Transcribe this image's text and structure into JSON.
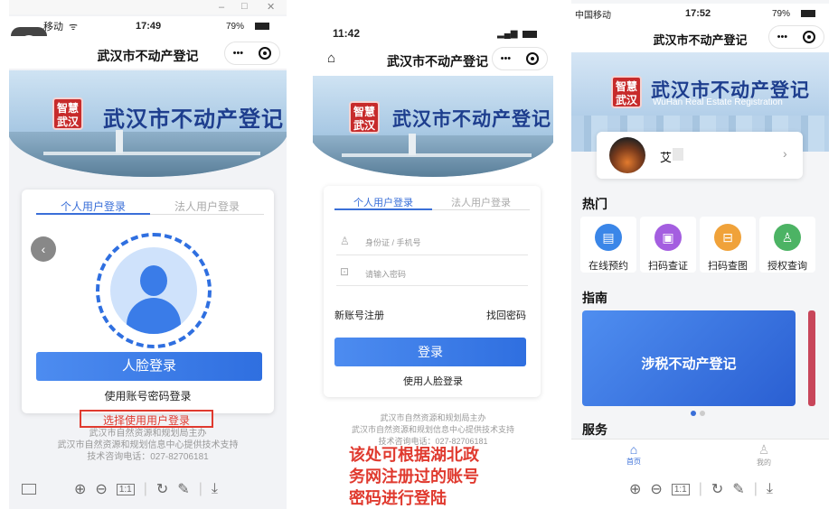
{
  "panel1": {
    "status": {
      "carrier": "移动",
      "time": "17:49",
      "battery": "79%"
    },
    "nav_title": "武汉市不动产登记",
    "capsule_more": "•••",
    "banner_title": "武汉市不动产登记",
    "logo_text": "智慧武汉",
    "tabs": {
      "personal": "个人用户登录",
      "legal": "法人用户登录"
    },
    "face_button": "人脸登录",
    "password_link": "使用账号密码登录",
    "annotation": "选择使用用户登录",
    "footer": [
      "武汉市自然资源和规划局主办",
      "武汉市自然资源和规划信息中心提供技术支持",
      "技术咨询电话：027-82706181"
    ]
  },
  "panel2": {
    "status": {
      "time": "11:42"
    },
    "nav_title": "武汉市不动产登记",
    "capsule_more": "•••",
    "banner_title": "武汉市不动产登记",
    "logo_text": "智慧武汉",
    "tabs": {
      "personal": "个人用户登录",
      "legal": "法人用户登录"
    },
    "id_placeholder": "身份证 / 手机号",
    "password_placeholder": "请输入密码",
    "register_link": "新账号注册",
    "recover_link": "找回密码",
    "login_button": "登录",
    "face_link": "使用人脸登录",
    "footer": [
      "武汉市自然资源和规划局主办",
      "武汉市自然资源和规划信息中心提供技术支持",
      "技术咨询电话：027-82706181"
    ],
    "annotation": [
      "该处可根据湖北政",
      "务网注册过的账号",
      "密码进行登陆"
    ]
  },
  "panel3": {
    "status": {
      "carrier": "中国移动",
      "time": "17:52",
      "battery": "79%"
    },
    "nav_title": "武汉市不动产登记",
    "capsule_more": "•••",
    "banner_title": "武汉市不动产登记",
    "banner_subtitle": "WuHan Real Estate Registration",
    "logo_text": "智慧武汉",
    "user_name": "艾",
    "section_hot": "热门",
    "hot_items": [
      {
        "label": "在线预约",
        "color": "#3a86e8",
        "icon": "calendar-icon"
      },
      {
        "label": "扫码查证",
        "color": "#a45ee0",
        "icon": "scan-cert-icon"
      },
      {
        "label": "扫码查图",
        "color": "#f0a23a",
        "icon": "scan-map-icon"
      },
      {
        "label": "授权查询",
        "color": "#4cb364",
        "icon": "person-icon"
      }
    ],
    "section_guide": "指南",
    "guide_card": "涉税不动产登记",
    "section_service": "服务",
    "tabbar": {
      "home": "首页",
      "mine": "我的"
    }
  },
  "colors": {
    "accent": "#2f6fe0",
    "annotation_red": "#e03a2f",
    "title_blue": "#1e3e8e"
  }
}
